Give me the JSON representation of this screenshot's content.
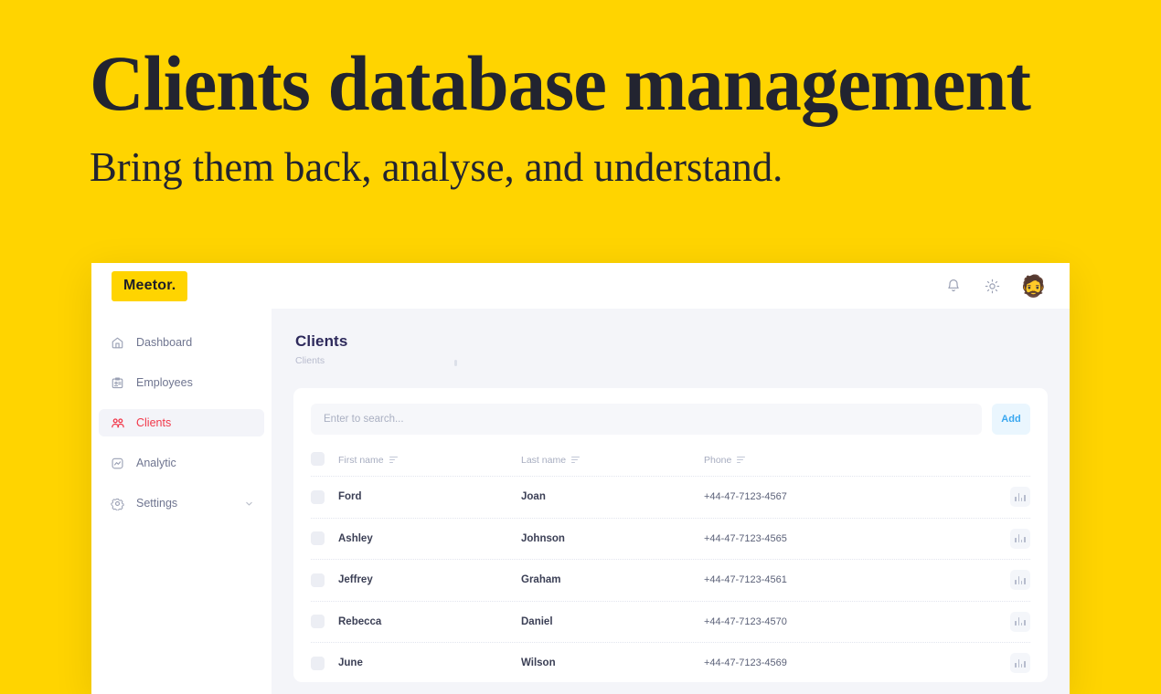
{
  "hero": {
    "title": "Clients database management",
    "subtitle": "Bring them back, analyse, and understand.",
    "background_color": "#FFD400",
    "text_color": "#222430"
  },
  "app": {
    "logo": "Meetor.",
    "logo_background": "#FFD400",
    "topbar": {
      "icons": [
        {
          "name": "bell-icon",
          "label": "Notifications"
        },
        {
          "name": "gear-icon",
          "label": "Settings"
        }
      ],
      "avatar": "🧔"
    },
    "sidebar": {
      "items": [
        {
          "label": "Dashboard",
          "icon": "home-icon",
          "active": false
        },
        {
          "label": "Employees",
          "icon": "id-card-icon",
          "active": false
        },
        {
          "label": "Clients",
          "icon": "people-icon",
          "active": true
        },
        {
          "label": "Analytic",
          "icon": "analytics-icon",
          "active": false
        },
        {
          "label": "Settings",
          "icon": "gear-icon",
          "active": false,
          "chevron": true
        }
      ],
      "active_color": "#f2384a",
      "inactive_color": "#6f7590"
    },
    "page": {
      "title": "Clients",
      "breadcrumb": "Clients"
    },
    "search": {
      "placeholder": "Enter to search...",
      "value": ""
    },
    "add_button": {
      "label": "Add",
      "color": "#39a7f0",
      "background": "#eaf6fe"
    },
    "table": {
      "columns": [
        {
          "label": "First name",
          "sortable": true
        },
        {
          "label": "Last name",
          "sortable": true
        },
        {
          "label": "Phone",
          "sortable": true
        }
      ],
      "rows": [
        {
          "first_name": "Ford",
          "last_name": "Joan",
          "phone": "+44-47-7123-4567"
        },
        {
          "first_name": "Ashley",
          "last_name": "Johnson",
          "phone": "+44-47-7123-4565"
        },
        {
          "first_name": "Jeffrey",
          "last_name": "Graham",
          "phone": "+44-47-7123-4561"
        },
        {
          "first_name": "Rebecca",
          "last_name": "Daniel",
          "phone": "+44-47-7123-4570"
        },
        {
          "first_name": "June",
          "last_name": "Wilson",
          "phone": "+44-47-7123-4569"
        }
      ],
      "row_action_icon": "bar-chart-icon"
    }
  }
}
